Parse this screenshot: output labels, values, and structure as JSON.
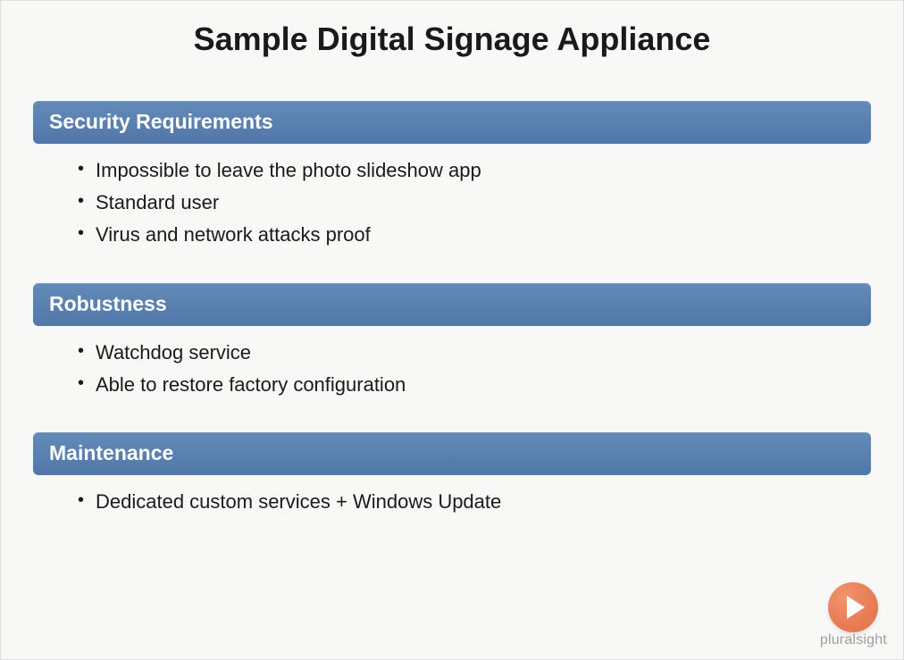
{
  "title": "Sample Digital Signage Appliance",
  "sections": [
    {
      "heading": "Security Requirements",
      "items": [
        "Impossible to leave the photo slideshow app",
        "Standard user",
        "Virus and network attacks proof"
      ]
    },
    {
      "heading": "Robustness",
      "items": [
        "Watchdog service",
        "Able to restore factory configuration"
      ]
    },
    {
      "heading": "Maintenance",
      "items": [
        "Dedicated custom services + Windows Update"
      ]
    }
  ],
  "brand": "pluralsight"
}
